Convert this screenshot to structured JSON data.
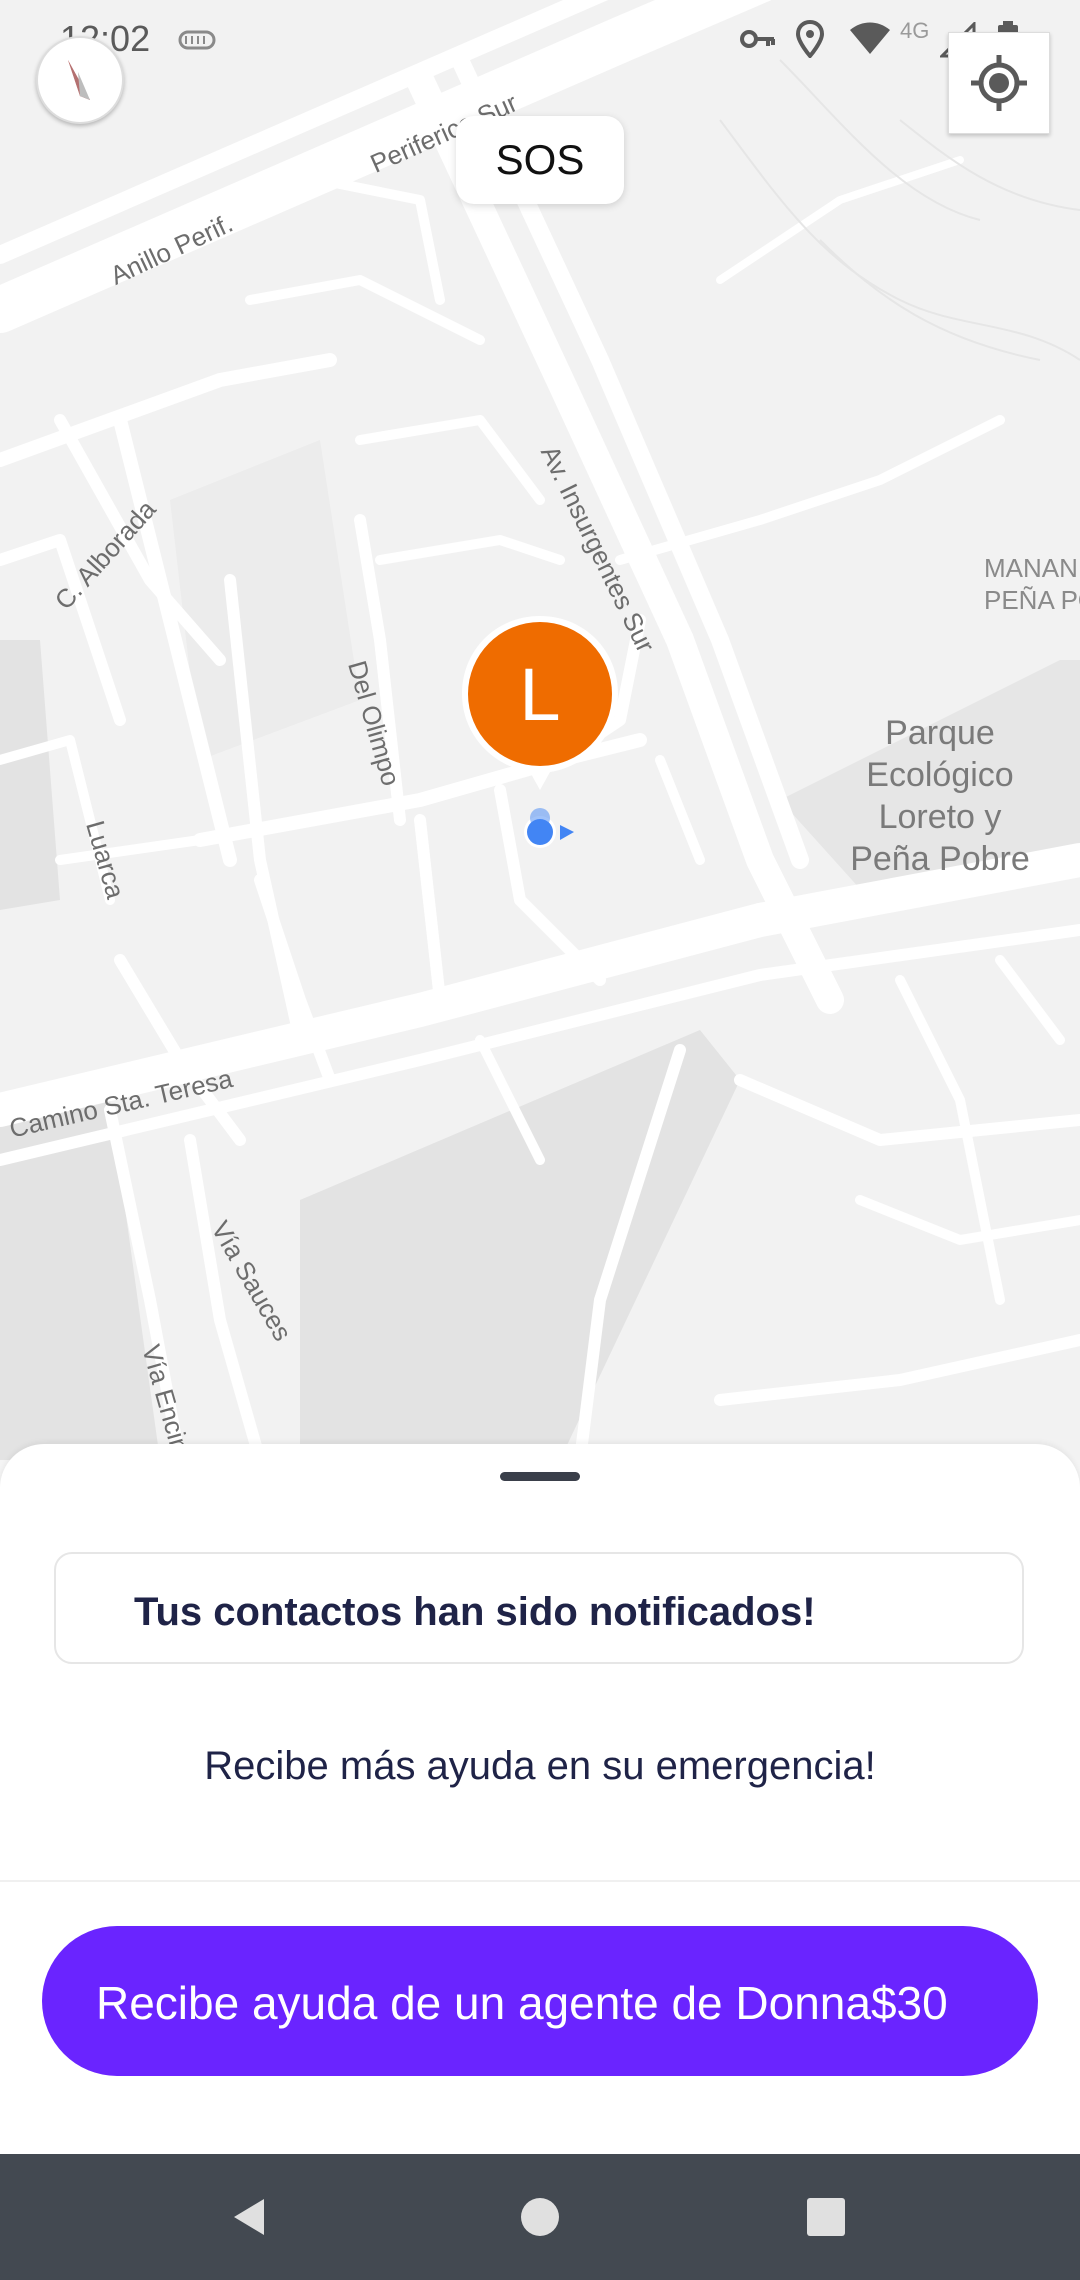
{
  "status_bar": {
    "time": "12:02",
    "network_label": "4G"
  },
  "map": {
    "sos_label": "SOS",
    "marker_letter": "L",
    "road_labels": {
      "periferico_sur": "Periferico Sur",
      "anillo_perif": "Anillo Perif.",
      "av_insurgentes_sur": "Av. Insurgentes Sur",
      "c_alborada": "C. Alborada",
      "del_olimpo": "Del Olimpo",
      "luarca": "Luarca",
      "camino_sta_teresa": "Camino Sta. Teresa",
      "via_sauces": "Vía Sauces",
      "via_encino": "Vía Encino"
    },
    "poi": {
      "park": "Parque Ecológico Loreto y Peña Pobre",
      "park_lines": [
        "Parque",
        "Ecológico",
        "Loreto y",
        "Peña Pobre"
      ],
      "mananas_lines": [
        "MANAN",
        "PEÑA PO"
      ]
    }
  },
  "sheet": {
    "notice": "Tus contactos han sido notificados!",
    "subtitle": "Recibe más ayuda en su emergencia!",
    "cta_label": "Recibe ayuda de un agente de Donna$30"
  },
  "colors": {
    "accent": "#6a24ff",
    "marker": "#ef6c00",
    "user_dot": "#4285f4",
    "text_dark": "#1f2347"
  },
  "icons": [
    "vpn-key-icon",
    "location-pin-icon",
    "wifi-icon",
    "cell-signal-icon",
    "battery-icon",
    "compass-icon",
    "my-location-icon",
    "back-icon",
    "home-icon",
    "recents-icon"
  ]
}
